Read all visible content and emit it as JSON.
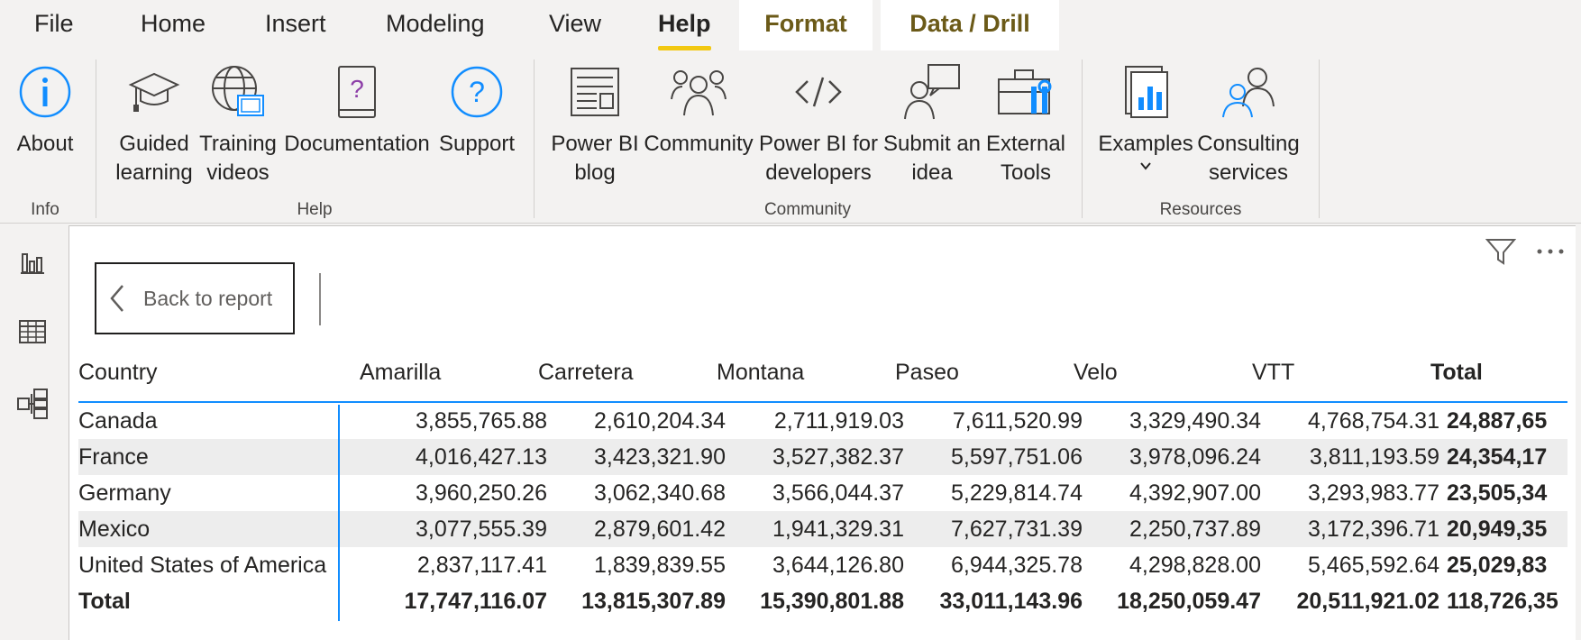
{
  "tabs": [
    {
      "label": "File"
    },
    {
      "label": "Home"
    },
    {
      "label": "Insert"
    },
    {
      "label": "Modeling"
    },
    {
      "label": "View"
    },
    {
      "label": "Help",
      "active": true
    },
    {
      "label": "Format",
      "contextual": true
    },
    {
      "label": "Data / Drill",
      "contextual": true
    }
  ],
  "ribbon": {
    "buttons": {
      "about": "About",
      "guided_learning": "Guided\nlearning",
      "training_videos": "Training\nvideos",
      "documentation": "Documentation",
      "support": "Support",
      "blog": "Power BI\nblog",
      "community": "Community",
      "developers": "Power BI for\ndevelopers",
      "submit_idea": "Submit an\nidea",
      "external_tools": "External\nTools",
      "examples": "Examples",
      "consulting": "Consulting\nservices"
    },
    "groups": {
      "info": "Info",
      "help": "Help",
      "community": "Community",
      "resources": "Resources"
    }
  },
  "rail": [
    "report-view-icon",
    "data-view-icon",
    "model-view-icon"
  ],
  "canvas": {
    "back_label": "Back to report"
  },
  "matrix": {
    "columns": [
      "Country",
      "Amarilla",
      "Carretera",
      "Montana",
      "Paseo",
      "Velo",
      "VTT",
      "Total"
    ],
    "rows": [
      {
        "country": "Canada",
        "values": [
          "3,855,765.88",
          "2,610,204.34",
          "2,711,919.03",
          "7,611,520.99",
          "3,329,490.34",
          "4,768,754.31"
        ],
        "total": "24,887,65"
      },
      {
        "country": "France",
        "values": [
          "4,016,427.13",
          "3,423,321.90",
          "3,527,382.37",
          "5,597,751.06",
          "3,978,096.24",
          "3,811,193.59"
        ],
        "total": "24,354,17"
      },
      {
        "country": "Germany",
        "values": [
          "3,960,250.26",
          "3,062,340.68",
          "3,566,044.37",
          "5,229,814.74",
          "4,392,907.00",
          "3,293,983.77"
        ],
        "total": "23,505,34"
      },
      {
        "country": "Mexico",
        "values": [
          "3,077,555.39",
          "2,879,601.42",
          "1,941,329.31",
          "7,627,731.39",
          "2,250,737.89",
          "3,172,396.71"
        ],
        "total": "20,949,35"
      },
      {
        "country": "United States of America",
        "values": [
          "2,837,117.41",
          "1,839,839.55",
          "3,644,126.80",
          "6,944,325.78",
          "4,298,828.00",
          "5,465,592.64"
        ],
        "total": "25,029,83"
      }
    ],
    "totals": {
      "label": "Total",
      "values": [
        "17,747,116.07",
        "13,815,307.89",
        "15,390,801.88",
        "33,011,143.96",
        "18,250,059.47",
        "20,511,921.02"
      ],
      "total": "118,726,35"
    }
  },
  "colors": {
    "accent": "#118dff",
    "active_tab_underline": "#f2c811",
    "contextual_tab_text": "#6b5a18",
    "icon_blue": "#118dff",
    "documentation_icon": "#8d3fa8"
  }
}
